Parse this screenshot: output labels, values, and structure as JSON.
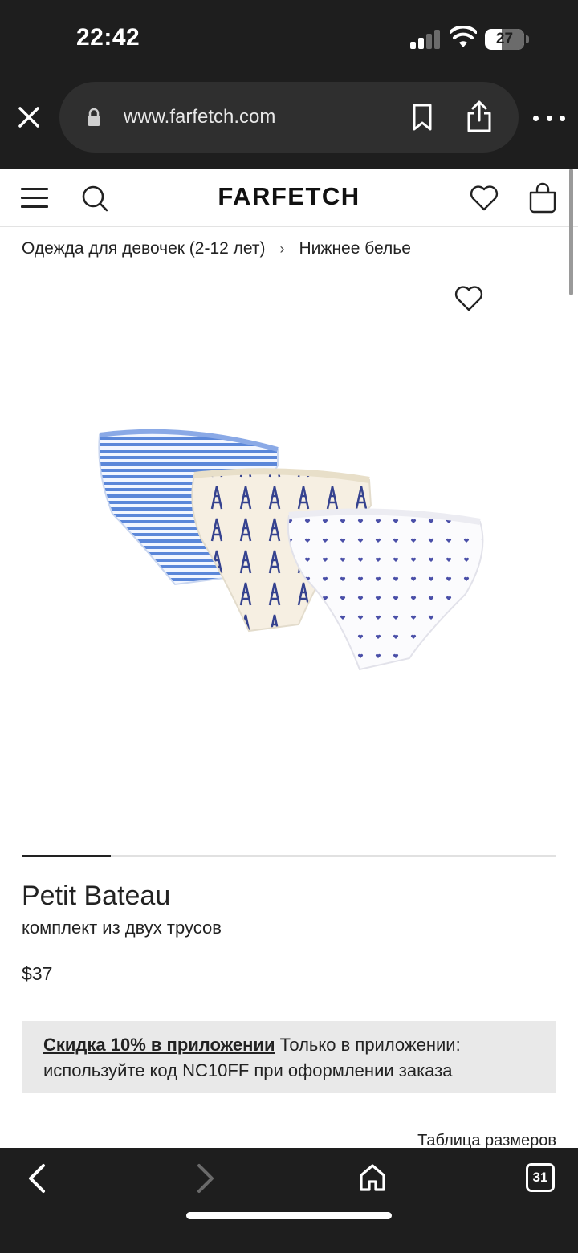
{
  "status_bar": {
    "time": "22:42",
    "battery": "27",
    "icons": [
      "signal-icon",
      "wifi-icon",
      "battery-icon"
    ]
  },
  "browser": {
    "url": "www.farfetch.com",
    "icons": [
      "close-icon",
      "lock-icon",
      "bookmark-icon",
      "share-icon",
      "more-icon"
    ]
  },
  "site_header": {
    "logo": "FARFETCH",
    "icons": [
      "menu-icon",
      "search-icon",
      "heart-icon",
      "bag-icon"
    ]
  },
  "breadcrumb": {
    "items": [
      "Одежда для девочек (2-12 лет)",
      "Нижнее белье"
    ],
    "separator": "›"
  },
  "product": {
    "brand": "Petit Bateau",
    "description": "комплект из двух трусов",
    "price": "$37",
    "carousel_progress": 0.167
  },
  "promo": {
    "link_text": "Скидка 10% в приложении",
    "text": " Только в приложении: используйте код NC10FF при оформлении заказа"
  },
  "size_chart_link": "Таблица размеров",
  "toolbar": {
    "tabs_count": "31",
    "icons": [
      "back-icon",
      "forward-icon",
      "home-icon",
      "tabs-icon"
    ]
  },
  "colors": {
    "chrome_bg": "#1e1e1e",
    "urlbar_bg": "#2f2f2f",
    "promo_bg": "#e9e9e9",
    "text": "#222222"
  }
}
